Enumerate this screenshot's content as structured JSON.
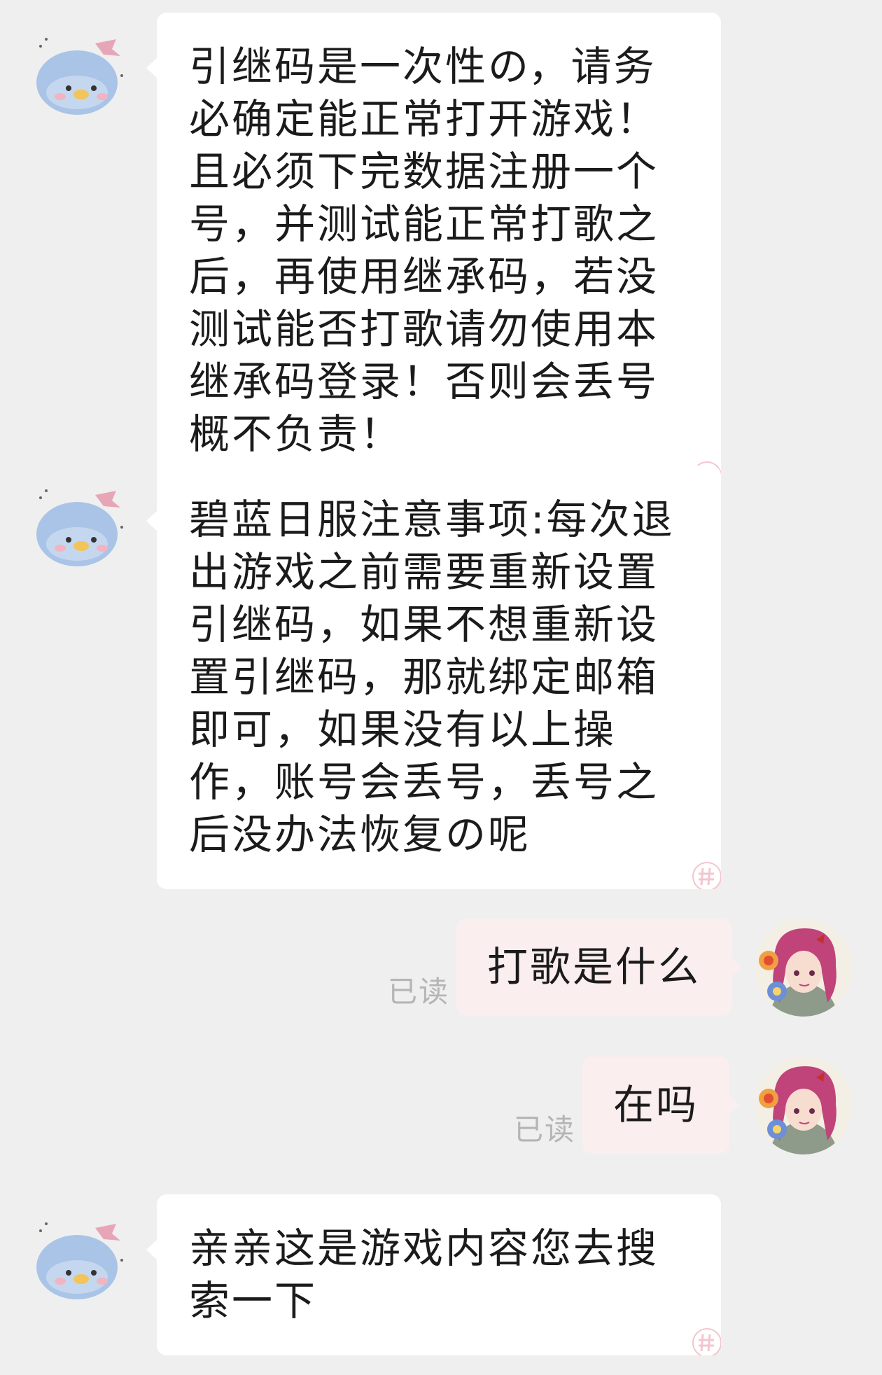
{
  "chat": {
    "messages": [
      {
        "side": "received",
        "text": "引继码是一次性の，请务必确定能正常打开游戏！且必须下完数据注册一个号，并测试能正常打歌之后，再使用继承码，若没测试能否打歌请勿使用本继承码登录！否则会丢号概不负责！"
      },
      {
        "side": "received",
        "text": "碧蓝日服注意事项:每次退出游戏之前需要重新设置引继码，如果不想重新设置引继码，那就绑定邮箱即可，如果没有以上操作，账号会丢号，丢号之后没办法恢复の呢"
      },
      {
        "side": "sent",
        "text": "打歌是什么",
        "status": "已读"
      },
      {
        "side": "sent",
        "text": "在吗",
        "status": "已读"
      },
      {
        "side": "received",
        "text": "亲亲这是游戏内容您去搜索一下"
      }
    ]
  },
  "colors": {
    "page_background": "#efefef",
    "received_bubble": "#ffffff",
    "sent_bubble": "#fbeeee",
    "read_status": "#b5b5b5",
    "mascot_blue": "#a9c4e6",
    "mascot_beak": "#f2c45a"
  },
  "icons": {
    "received_avatar": "penguin-mascot-icon",
    "sent_avatar": "anime-girl-avatar",
    "bubble_corner": "hash-stamp-icon"
  }
}
